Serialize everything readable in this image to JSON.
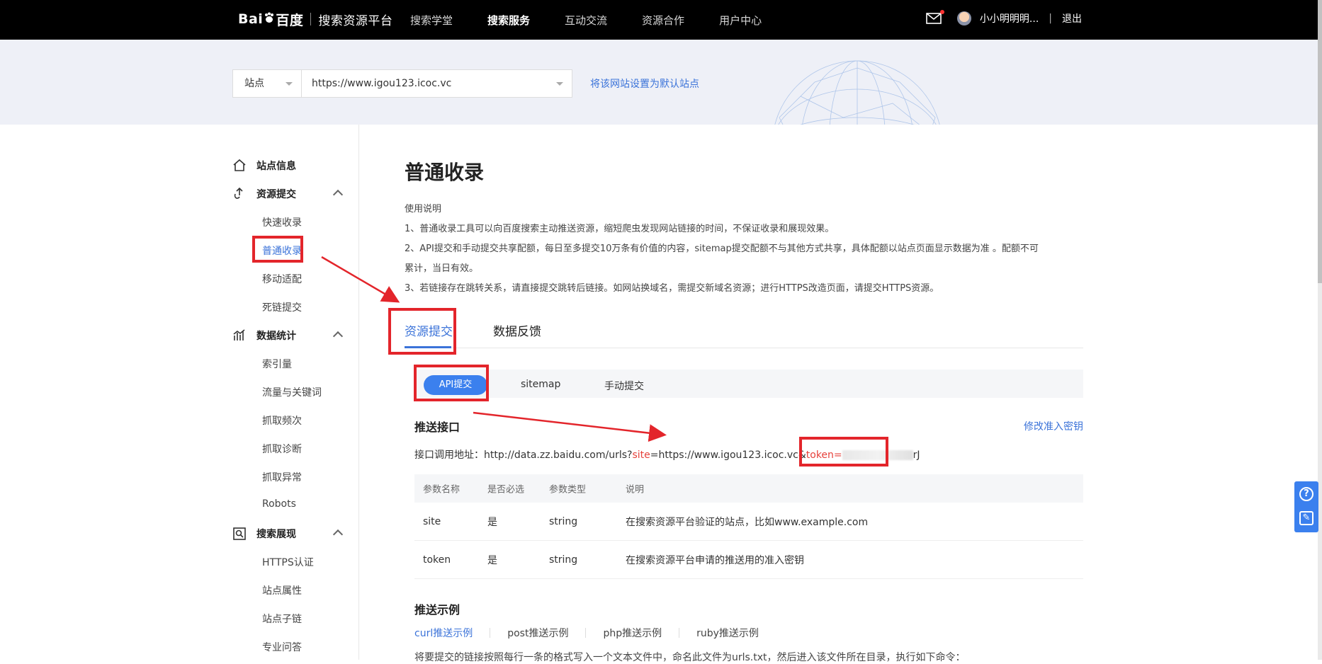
{
  "header": {
    "logo_text": "Bai",
    "logo_text_2": "百度",
    "platform": "搜索资源平台",
    "nav": [
      "搜索学堂",
      "搜索服务",
      "互动交流",
      "资源合作",
      "用户中心"
    ],
    "active_nav_index": 1,
    "username": "小小明明明...",
    "separator": "|",
    "logout": "退出"
  },
  "site_bar": {
    "select_label": "站点",
    "url": "https://www.igou123.icoc.vc",
    "default_link": "将该网站设置为默认站点"
  },
  "sidebar": {
    "groups": [
      {
        "label": "站点信息",
        "icon": "home-icon"
      },
      {
        "label": "资源提交",
        "icon": "submit-icon",
        "items": [
          "快速收录",
          "普通收录",
          "移动适配",
          "死链提交"
        ]
      },
      {
        "label": "数据统计",
        "icon": "stats-icon",
        "items": [
          "索引量",
          "流量与关键词",
          "抓取频次",
          "抓取诊断",
          "抓取异常",
          "Robots"
        ]
      },
      {
        "label": "搜索展现",
        "icon": "search-display-icon",
        "items": [
          "HTTPS认证",
          "站点属性",
          "站点子链",
          "专业问答"
        ]
      }
    ],
    "active_item": "普通收录"
  },
  "main": {
    "title": "普通收录",
    "intro": [
      "使用说明",
      "1、普通收录工具可以向百度搜索主动推送资源，缩短爬虫发现网站链接的时间，不保证收录和展现效果。",
      "2、API提交和手动提交共享配额，每日至多提交10万条有价值的内容，sitemap提交配额不与其他方式共享，具体配额以站点页面显示数据为准 。配额不可",
      "累计，当日有效。",
      "3、若链接存在跳转关系，请直接提交跳转后链接。如网站换域名，需提交新域名资源；进行HTTPS改造页面，请提交HTTPS资源。"
    ],
    "tabs": [
      "资源提交",
      "数据反馈"
    ],
    "subtabs": [
      "API提交",
      "sitemap",
      "手动提交"
    ],
    "push_title": "推送接口",
    "modify_link": "修改准入密钥",
    "api": {
      "prefix": "接口调用地址：http://data.zz.baidu.com/urls?",
      "site_key": "site",
      "mid": "=https://www.igou123.icoc.vc&",
      "token_key": "token",
      "eq": "=",
      "tail": "rJ"
    },
    "table": {
      "headers": [
        "参数名称",
        "是否必选",
        "参数类型",
        "说明"
      ],
      "rows": [
        [
          "site",
          "是",
          "string",
          "在搜索资源平台验证的站点，比如www.example.com"
        ],
        [
          "token",
          "是",
          "string",
          "在搜索资源平台申请的推送用的准入密钥"
        ]
      ]
    },
    "example_title": "推送示例",
    "example_tabs": [
      "curl推送示例",
      "post推送示例",
      "php推送示例",
      "ruby推送示例"
    ],
    "example_desc": "将要提交的链接按照每行一条的格式写入一个文本文件中，命名此文件为urls.txt，然后进入该文件所在目录，执行如下命令："
  },
  "float": {
    "help_icon": "question-icon",
    "feedback_icon": "edit-icon"
  },
  "colors": {
    "accent": "#3b73d9",
    "highlight": "#e3252b",
    "topbar": "#000000"
  }
}
